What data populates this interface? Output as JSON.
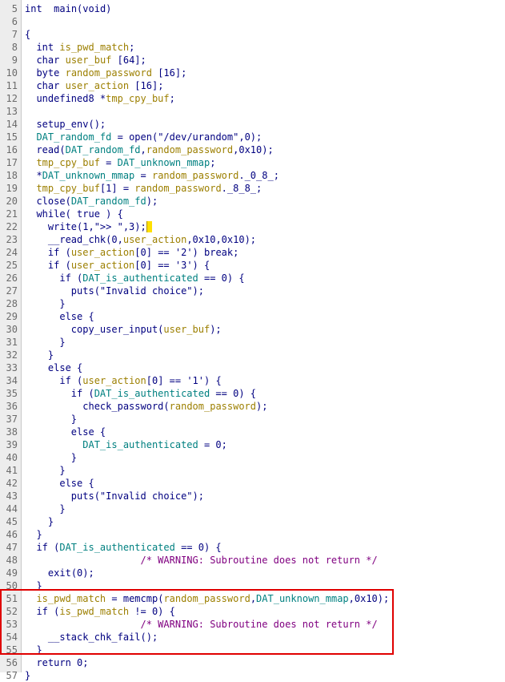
{
  "editor": {
    "lines": [
      {
        "n": "5",
        "tokens": [
          [
            "ty",
            "int"
          ],
          [
            "",
            "  "
          ],
          [
            "fn",
            "main"
          ],
          [
            "",
            "(void)"
          ]
        ]
      },
      {
        "n": "6",
        "tokens": []
      },
      {
        "n": "7",
        "tokens": [
          [
            "",
            "{"
          ]
        ]
      },
      {
        "n": "8",
        "tokens": [
          [
            "",
            "  "
          ],
          [
            "ty",
            "int"
          ],
          [
            "",
            " "
          ],
          [
            "var",
            "is_pwd_match"
          ],
          [
            "",
            ";"
          ]
        ]
      },
      {
        "n": "9",
        "tokens": [
          [
            "",
            "  "
          ],
          [
            "ty",
            "char"
          ],
          [
            "",
            " "
          ],
          [
            "var",
            "user_buf"
          ],
          [
            "",
            " [64];"
          ]
        ]
      },
      {
        "n": "10",
        "tokens": [
          [
            "",
            "  "
          ],
          [
            "ty",
            "byte"
          ],
          [
            "",
            " "
          ],
          [
            "var",
            "random_password"
          ],
          [
            "",
            " [16];"
          ]
        ]
      },
      {
        "n": "11",
        "tokens": [
          [
            "",
            "  "
          ],
          [
            "ty",
            "char"
          ],
          [
            "",
            " "
          ],
          [
            "var",
            "user_action"
          ],
          [
            "",
            " [16];"
          ]
        ]
      },
      {
        "n": "12",
        "tokens": [
          [
            "",
            "  "
          ],
          [
            "ty",
            "undefined8"
          ],
          [
            "",
            " *"
          ],
          [
            "var",
            "tmp_cpy_buf"
          ],
          [
            "",
            ";"
          ]
        ]
      },
      {
        "n": "13",
        "tokens": []
      },
      {
        "n": "14",
        "tokens": [
          [
            "",
            "  "
          ],
          [
            "fn",
            "setup_env"
          ],
          [
            "",
            "();"
          ]
        ]
      },
      {
        "n": "15",
        "tokens": [
          [
            "",
            "  "
          ],
          [
            "gvar",
            "DAT_random_fd"
          ],
          [
            "",
            " = "
          ],
          [
            "fn",
            "open"
          ],
          [
            "",
            "(\"/dev/urandom\",0);"
          ]
        ]
      },
      {
        "n": "16",
        "tokens": [
          [
            "",
            "  "
          ],
          [
            "fn",
            "read"
          ],
          [
            "",
            "("
          ],
          [
            "gvar",
            "DAT_random_fd"
          ],
          [
            "",
            ","
          ],
          [
            "var",
            "random_password"
          ],
          [
            "",
            ",0x10);"
          ]
        ]
      },
      {
        "n": "17",
        "tokens": [
          [
            "",
            "  "
          ],
          [
            "var",
            "tmp_cpy_buf"
          ],
          [
            "",
            " = "
          ],
          [
            "gvar",
            "DAT_unknown_mmap"
          ],
          [
            "",
            ";"
          ]
        ]
      },
      {
        "n": "18",
        "tokens": [
          [
            "",
            "  *"
          ],
          [
            "gvar",
            "DAT_unknown_mmap"
          ],
          [
            "",
            " = "
          ],
          [
            "var",
            "random_password"
          ],
          [
            "",
            "._0_8_;"
          ]
        ]
      },
      {
        "n": "19",
        "tokens": [
          [
            "",
            "  "
          ],
          [
            "var",
            "tmp_cpy_buf"
          ],
          [
            "",
            "[1] = "
          ],
          [
            "var",
            "random_password"
          ],
          [
            "",
            "._8_8_;"
          ]
        ]
      },
      {
        "n": "20",
        "tokens": [
          [
            "",
            "  "
          ],
          [
            "fn",
            "close"
          ],
          [
            "",
            "("
          ],
          [
            "gvar",
            "DAT_random_fd"
          ],
          [
            "",
            ");"
          ]
        ]
      },
      {
        "n": "21",
        "tokens": [
          [
            "",
            "  "
          ],
          [
            "kw",
            "while"
          ],
          [
            "",
            "( "
          ],
          [
            "kw",
            "true"
          ],
          [
            "",
            " ) {"
          ]
        ]
      },
      {
        "n": "22",
        "tokens": [
          [
            "",
            "    "
          ],
          [
            "fn",
            "write"
          ],
          [
            "",
            "(1,\">> \",3);"
          ],
          [
            "cursor",
            ""
          ]
        ]
      },
      {
        "n": "23",
        "tokens": [
          [
            "",
            "    "
          ],
          [
            "fn",
            "__read_chk"
          ],
          [
            "",
            "(0,"
          ],
          [
            "var",
            "user_action"
          ],
          [
            "",
            ",0x10,0x10);"
          ]
        ]
      },
      {
        "n": "24",
        "tokens": [
          [
            "",
            "    "
          ],
          [
            "kw",
            "if"
          ],
          [
            "",
            " ("
          ],
          [
            "var",
            "user_action"
          ],
          [
            "",
            "[0] == '2') "
          ],
          [
            "kw",
            "break"
          ],
          [
            "",
            ";"
          ]
        ]
      },
      {
        "n": "25",
        "tokens": [
          [
            "",
            "    "
          ],
          [
            "kw",
            "if"
          ],
          [
            "",
            " ("
          ],
          [
            "var",
            "user_action"
          ],
          [
            "",
            "[0] == '3') {"
          ]
        ]
      },
      {
        "n": "26",
        "tokens": [
          [
            "",
            "      "
          ],
          [
            "kw",
            "if"
          ],
          [
            "",
            " ("
          ],
          [
            "gvar",
            "DAT_is_authenticated"
          ],
          [
            "",
            " == 0) {"
          ]
        ]
      },
      {
        "n": "27",
        "tokens": [
          [
            "",
            "        "
          ],
          [
            "fn",
            "puts"
          ],
          [
            "",
            "(\"Invalid choice\");"
          ]
        ]
      },
      {
        "n": "28",
        "tokens": [
          [
            "",
            "      }"
          ]
        ]
      },
      {
        "n": "29",
        "tokens": [
          [
            "",
            "      "
          ],
          [
            "kw",
            "else"
          ],
          [
            "",
            " {"
          ]
        ]
      },
      {
        "n": "30",
        "tokens": [
          [
            "",
            "        "
          ],
          [
            "fn",
            "copy_user_input"
          ],
          [
            "",
            "("
          ],
          [
            "var",
            "user_buf"
          ],
          [
            "",
            ");"
          ]
        ]
      },
      {
        "n": "31",
        "tokens": [
          [
            "",
            "      }"
          ]
        ]
      },
      {
        "n": "32",
        "tokens": [
          [
            "",
            "    }"
          ]
        ]
      },
      {
        "n": "33",
        "tokens": [
          [
            "",
            "    "
          ],
          [
            "kw",
            "else"
          ],
          [
            "",
            " {"
          ]
        ]
      },
      {
        "n": "34",
        "tokens": [
          [
            "",
            "      "
          ],
          [
            "kw",
            "if"
          ],
          [
            "",
            " ("
          ],
          [
            "var",
            "user_action"
          ],
          [
            "",
            "[0] == '1') {"
          ]
        ]
      },
      {
        "n": "35",
        "tokens": [
          [
            "",
            "        "
          ],
          [
            "kw",
            "if"
          ],
          [
            "",
            " ("
          ],
          [
            "gvar",
            "DAT_is_authenticated"
          ],
          [
            "",
            " == 0) {"
          ]
        ]
      },
      {
        "n": "36",
        "tokens": [
          [
            "",
            "          "
          ],
          [
            "fn",
            "check_password"
          ],
          [
            "",
            "("
          ],
          [
            "var",
            "random_password"
          ],
          [
            "",
            ");"
          ]
        ]
      },
      {
        "n": "37",
        "tokens": [
          [
            "",
            "        }"
          ]
        ]
      },
      {
        "n": "38",
        "tokens": [
          [
            "",
            "        "
          ],
          [
            "kw",
            "else"
          ],
          [
            "",
            " {"
          ]
        ]
      },
      {
        "n": "39",
        "tokens": [
          [
            "",
            "          "
          ],
          [
            "gvar",
            "DAT_is_authenticated"
          ],
          [
            "",
            " = 0;"
          ]
        ]
      },
      {
        "n": "40",
        "tokens": [
          [
            "",
            "        }"
          ]
        ]
      },
      {
        "n": "41",
        "tokens": [
          [
            "",
            "      }"
          ]
        ]
      },
      {
        "n": "42",
        "tokens": [
          [
            "",
            "      "
          ],
          [
            "kw",
            "else"
          ],
          [
            "",
            " {"
          ]
        ]
      },
      {
        "n": "43",
        "tokens": [
          [
            "",
            "        "
          ],
          [
            "fn",
            "puts"
          ],
          [
            "",
            "(\"Invalid choice\");"
          ]
        ]
      },
      {
        "n": "44",
        "tokens": [
          [
            "",
            "      }"
          ]
        ]
      },
      {
        "n": "45",
        "tokens": [
          [
            "",
            "    }"
          ]
        ]
      },
      {
        "n": "46",
        "tokens": [
          [
            "",
            "  }"
          ]
        ]
      },
      {
        "n": "47",
        "tokens": [
          [
            "",
            "  "
          ],
          [
            "kw",
            "if"
          ],
          [
            "",
            " ("
          ],
          [
            "gvar",
            "DAT_is_authenticated"
          ],
          [
            "",
            " == 0) {"
          ]
        ]
      },
      {
        "n": "48",
        "tokens": [
          [
            "",
            "                    "
          ],
          [
            "com",
            "/* WARNING: Subroutine does not return */"
          ]
        ]
      },
      {
        "n": "49",
        "tokens": [
          [
            "",
            "    "
          ],
          [
            "fn",
            "exit"
          ],
          [
            "",
            "(0);"
          ]
        ]
      },
      {
        "n": "50",
        "tokens": [
          [
            "",
            "  }"
          ]
        ]
      },
      {
        "n": "51",
        "tokens": [
          [
            "",
            "  "
          ],
          [
            "var",
            "is_pwd_match"
          ],
          [
            "",
            " = "
          ],
          [
            "fn",
            "memcmp"
          ],
          [
            "",
            "("
          ],
          [
            "var",
            "random_password"
          ],
          [
            "",
            ","
          ],
          [
            "gvar",
            "DAT_unknown_mmap"
          ],
          [
            "",
            ",0x10);"
          ]
        ]
      },
      {
        "n": "52",
        "tokens": [
          [
            "",
            "  "
          ],
          [
            "kw",
            "if"
          ],
          [
            "",
            " ("
          ],
          [
            "var",
            "is_pwd_match"
          ],
          [
            "",
            " != 0) {"
          ]
        ]
      },
      {
        "n": "53",
        "tokens": [
          [
            "",
            "                    "
          ],
          [
            "com",
            "/* WARNING: Subroutine does not return */"
          ]
        ]
      },
      {
        "n": "54",
        "tokens": [
          [
            "",
            "    "
          ],
          [
            "fn",
            "__stack_chk_fail"
          ],
          [
            "",
            "();"
          ]
        ]
      },
      {
        "n": "55",
        "tokens": [
          [
            "",
            "  }"
          ]
        ]
      },
      {
        "n": "56",
        "tokens": [
          [
            "",
            "  "
          ],
          [
            "kw",
            "return"
          ],
          [
            "",
            " 0;"
          ]
        ]
      },
      {
        "n": "57",
        "tokens": [
          [
            "",
            "}"
          ]
        ]
      }
    ]
  },
  "colors": {
    "keyword": "#000080",
    "local_var": "#9c7f00",
    "global_var": "#008080",
    "comment": "#800080",
    "highlight_box": "#e00000",
    "cursor": "#ffe000"
  }
}
